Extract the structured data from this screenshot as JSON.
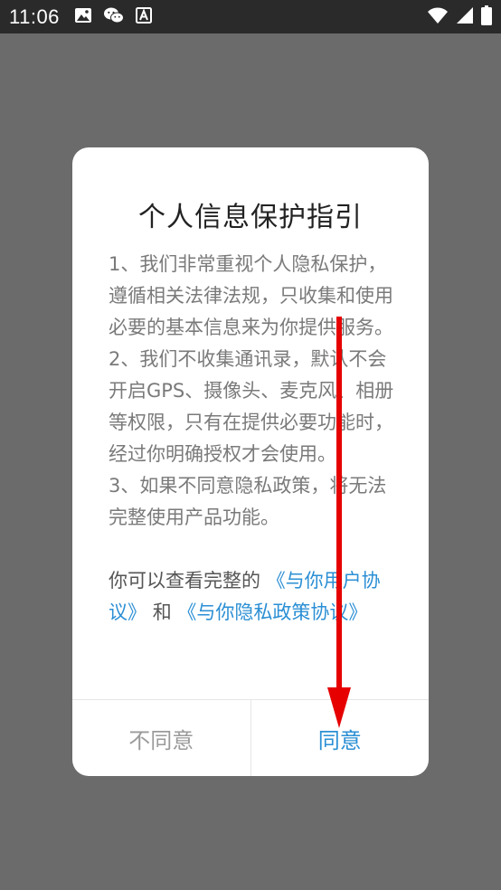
{
  "status_bar": {
    "time": "11:06",
    "icons_left": [
      "image-icon",
      "wechat-icon",
      "font-icon"
    ],
    "icons_right": [
      "wifi-icon",
      "signal-icon",
      "battery-icon"
    ]
  },
  "dialog": {
    "title": "个人信息保护指引",
    "paragraphs": [
      "1、我们非常重视个人隐私保护，遵循相关法律法规，只收集和使用必要的基本信息来为你提供服务。",
      "2、我们不收集通讯录，默认不会开启GPS、摄像头、麦克风、相册等权限，只有在提供必要功能时，经过你明确授权才会使用。",
      "3、如果不同意隐私政策，将无法完整使用产品功能。"
    ],
    "link_prefix": "你可以查看完整的",
    "user_agreement_link": "《与你用户协议》",
    "and_text": "和",
    "privacy_policy_link": "《与你隐私政策协议》",
    "disagree_label": "不同意",
    "agree_label": "同意"
  },
  "colors": {
    "accent": "#2b8fd4",
    "annotation_arrow": "#e60000",
    "overlay": "#6b6b6b",
    "status_bar": "#2a2a2a"
  }
}
